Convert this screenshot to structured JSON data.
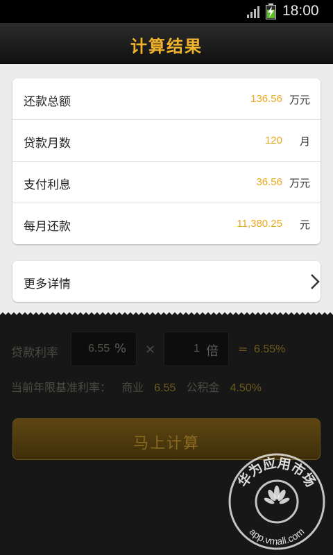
{
  "status_bar": {
    "time": "18:00"
  },
  "header": {
    "title": "计算结果"
  },
  "results": [
    {
      "label": "还款总额",
      "value": "136.56",
      "unit": "万元"
    },
    {
      "label": "贷款月数",
      "value": "120",
      "unit": "月"
    },
    {
      "label": "支付利息",
      "value": "36.56",
      "unit": "万元"
    },
    {
      "label": "每月还款",
      "value": "11,380.25",
      "unit": "元"
    }
  ],
  "more": {
    "label": "更多详情"
  },
  "form": {
    "rate_label": "贷款利率",
    "rate_value": "6.55",
    "rate_suffix": "%",
    "times_symbol": "×",
    "multiplier_value": "1",
    "multiplier_suffix": "倍",
    "equals": "=",
    "result": "6.55%",
    "base_label": "当前年限基准利率：",
    "commercial_label": "商业",
    "commercial_value": "6.55",
    "fund_label": "公积金",
    "fund_value": "4.50%"
  },
  "calc_button": {
    "label": "马上计算"
  },
  "watermark": {
    "text_cn": "华为应用市场",
    "text_url": "app.vmall.com",
    "logo_text": "HUAWEI"
  },
  "colors": {
    "accent": "#f0b32c",
    "value": "#e8a820",
    "button": "#5d4612"
  }
}
